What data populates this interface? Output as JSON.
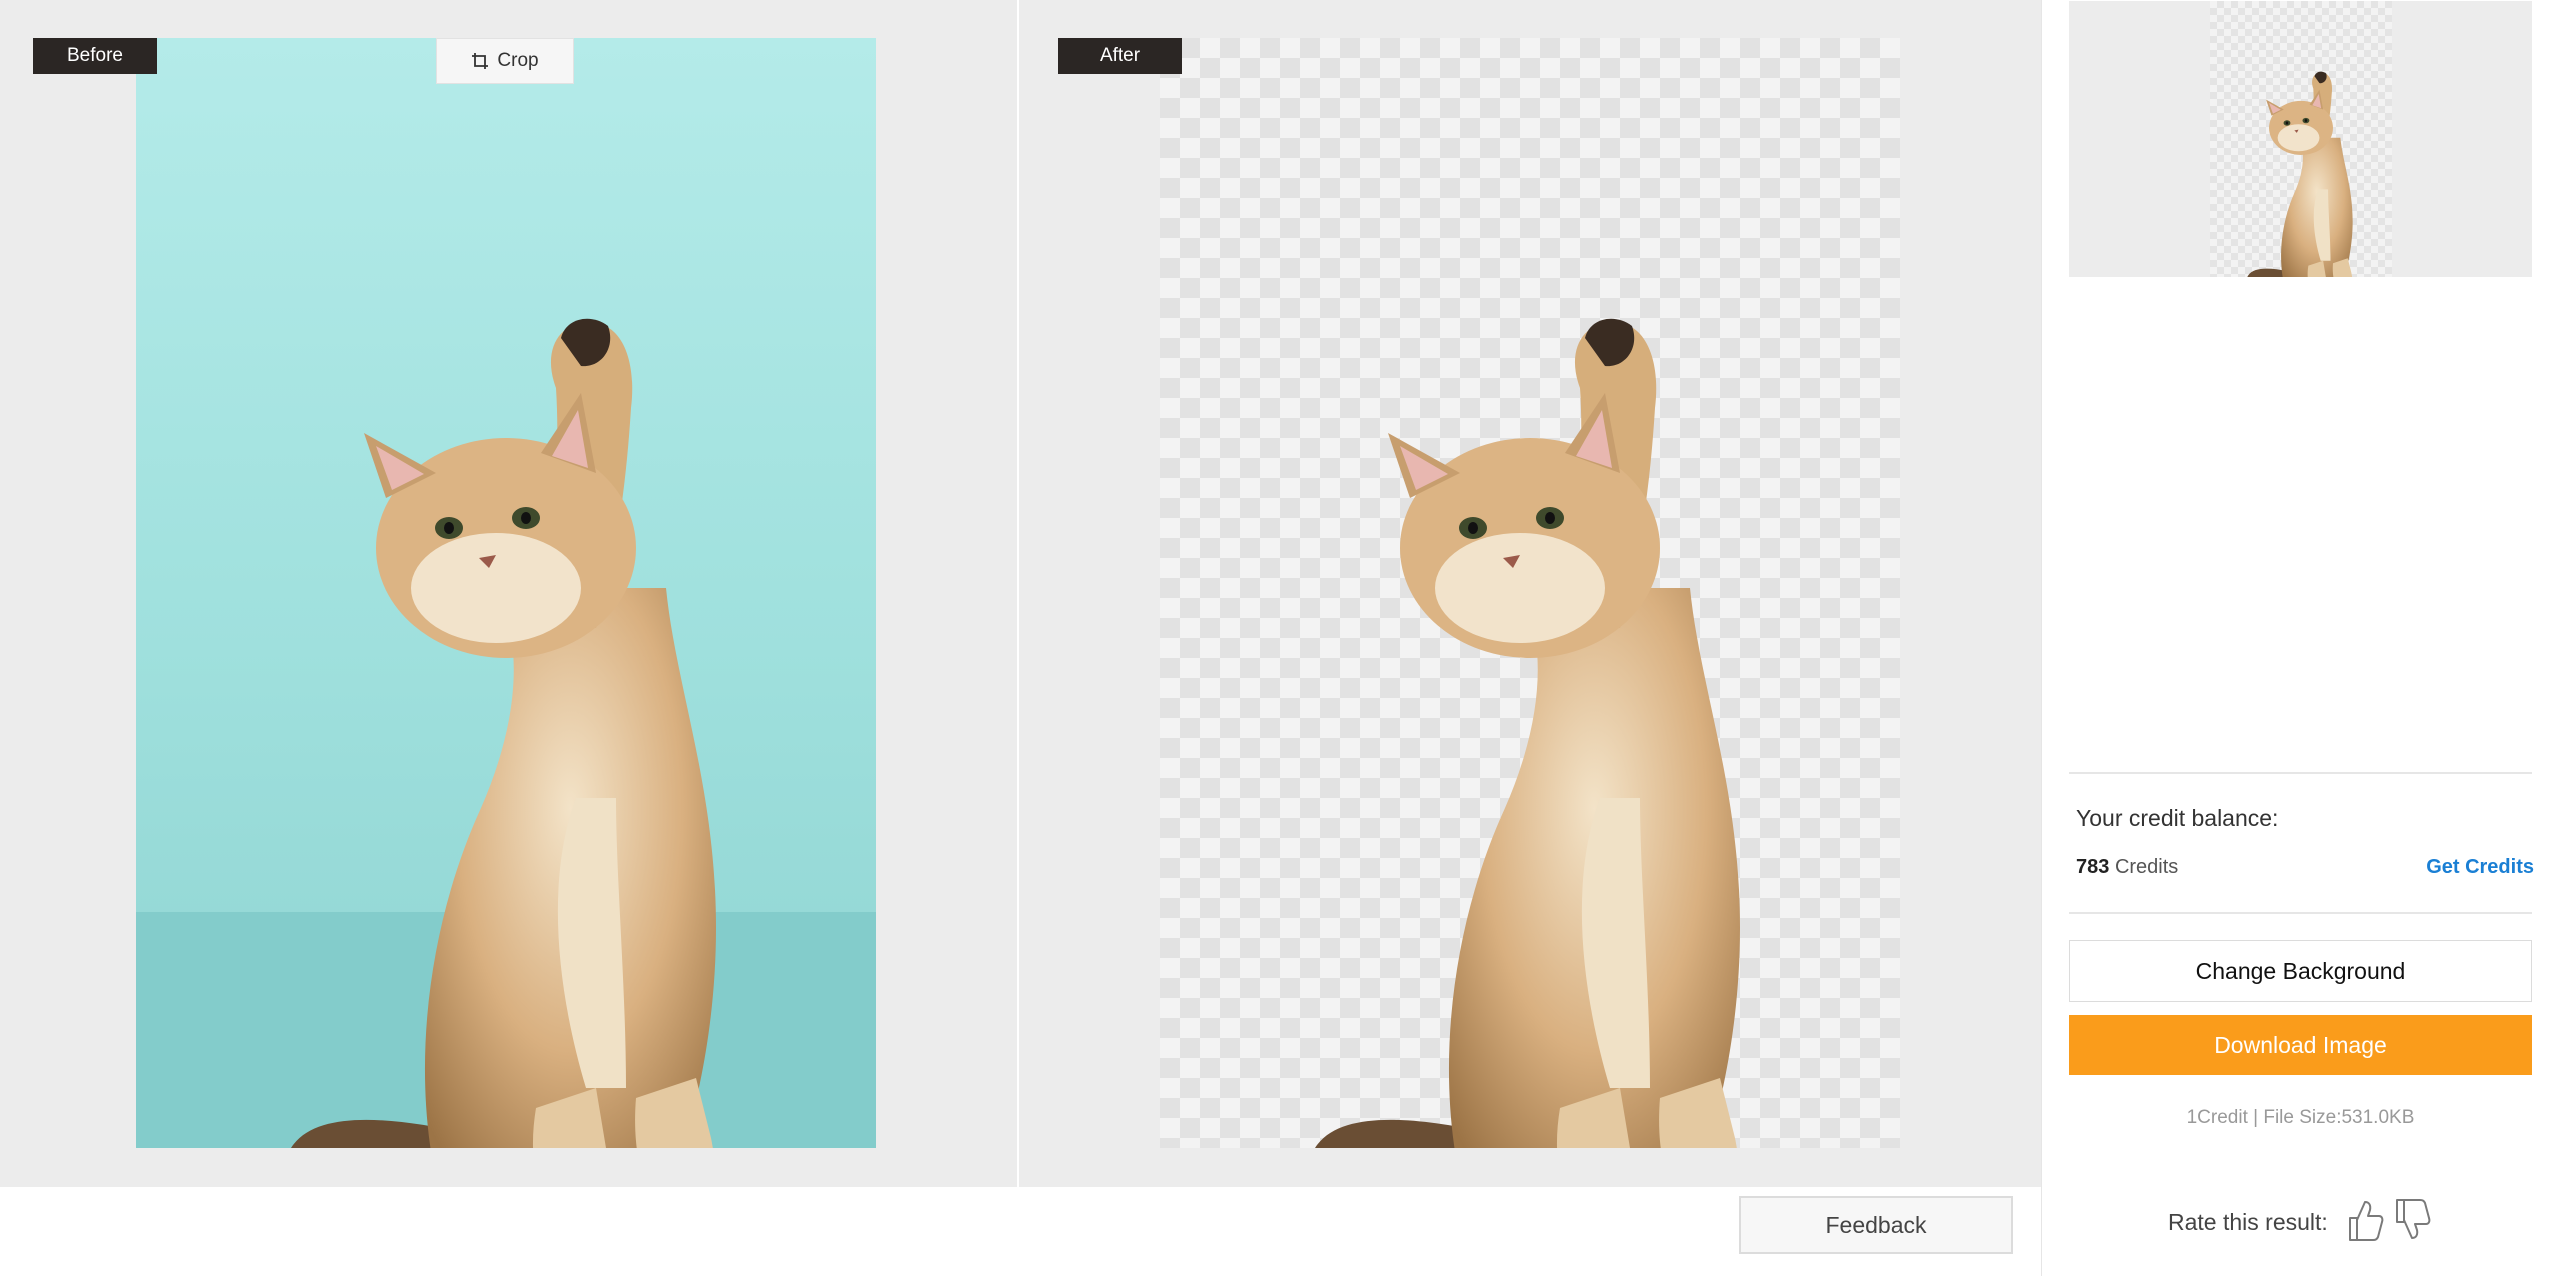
{
  "compare": {
    "before_label": "Before",
    "after_label": "After",
    "crop_label": "Crop"
  },
  "feedback_label": "Feedback",
  "sidebar": {
    "credit_title": "Your credit balance:",
    "credit_count": "783",
    "credit_unit": "Credits",
    "get_credits": "Get Credits",
    "change_background": "Change Background",
    "download": "Download Image",
    "file_info": "1Credit | File Size:531.0KB",
    "rate_label": "Rate this result:"
  },
  "colors": {
    "accent_orange": "#fa9c1b",
    "link_blue": "#1a7fd4",
    "label_dark": "#2b2624",
    "panel_gray": "#ececec",
    "before_bg": "#a6e3e1"
  },
  "icons": [
    "crop-icon",
    "thumbs-up-icon",
    "thumbs-down-icon"
  ]
}
